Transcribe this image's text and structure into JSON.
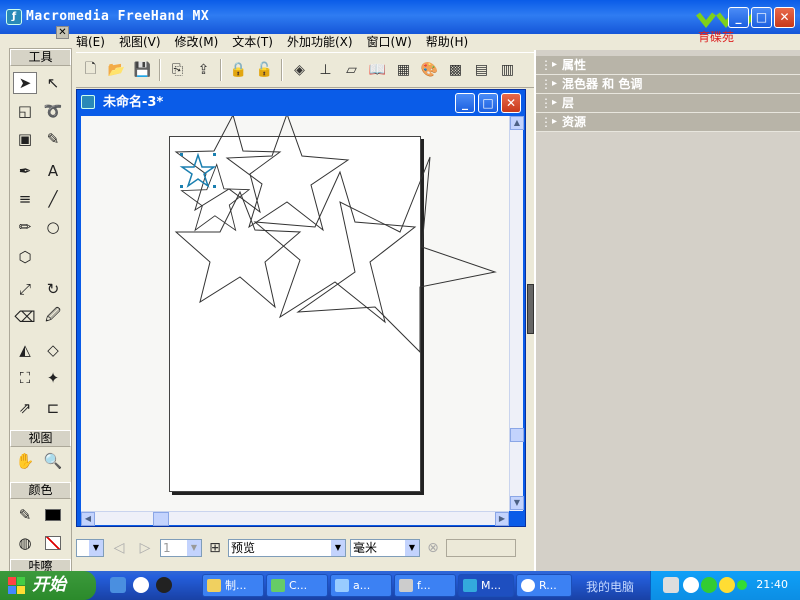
{
  "app": {
    "title": "Macromedia FreeHand MX",
    "logo_text": "育碟苑"
  },
  "menu": [
    "辑(E)",
    "视图(V)",
    "修改(M)",
    "文本(T)",
    "外加功能(X)",
    "窗口(W)",
    "帮助(H)"
  ],
  "toolbox": {
    "title": "工具",
    "view_section": "视图",
    "color_section": "颜色",
    "bottom_section": "咔嚓"
  },
  "panel": {
    "items": [
      "属性",
      "混色器 和 色调",
      "层",
      "资源"
    ]
  },
  "document": {
    "title": "未命名-3*"
  },
  "status": {
    "view_mode": "预览",
    "unit": "毫米",
    "page": "1"
  },
  "taskbar": {
    "start": "开始",
    "tasks": [
      "制...",
      "C...",
      "a...",
      "f...",
      "M...",
      "R..."
    ],
    "my_computer": "我的电脑",
    "clock": "21:40"
  },
  "colors": {
    "titlebar": "#0a5ce8",
    "panel_header": "#b8b4a8",
    "selection": "#1a7fb0"
  }
}
